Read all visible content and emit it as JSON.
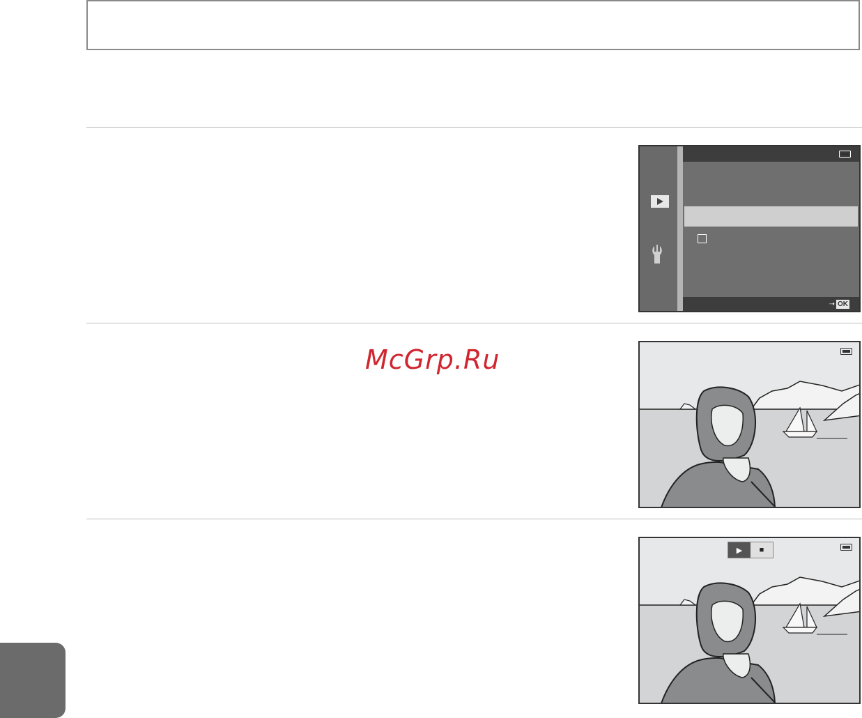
{
  "watermark": "McGrp.Ru",
  "menu_screen": {
    "icons": [
      "play-icon",
      "wrench-icon",
      "checkbox-icon",
      "battery-icon",
      "arrow-icon"
    ],
    "ok_label": "OK"
  },
  "photo_screens": [
    {
      "icons": [
        "battery-icon"
      ]
    },
    {
      "icons": [
        "play-icon",
        "stop-icon",
        "battery-icon"
      ]
    }
  ],
  "colors": {
    "watermark": "#d0262f",
    "tab": "#6b6b6b",
    "menu_bg": "#6f6f6f",
    "highlight": "#cfcfcf"
  }
}
